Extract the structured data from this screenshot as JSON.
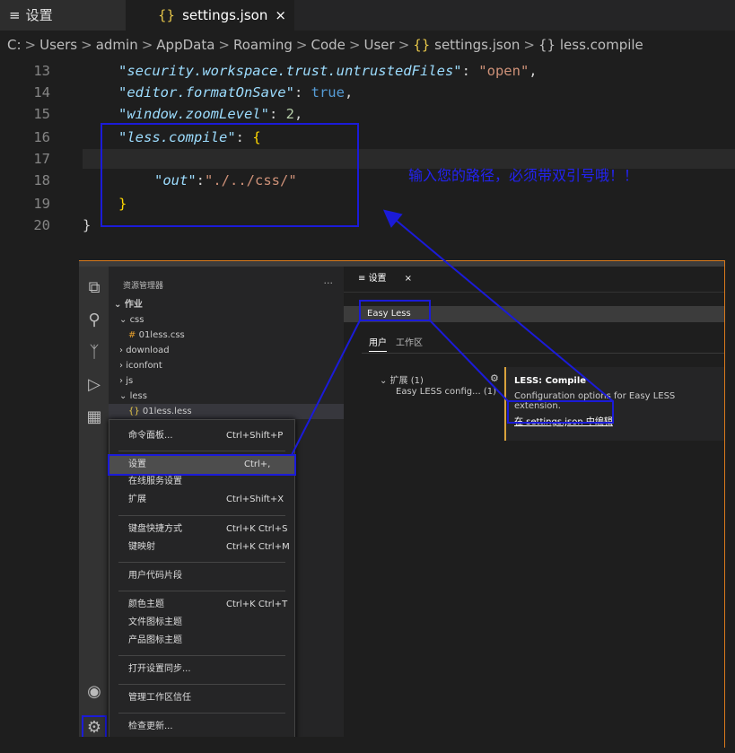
{
  "tabs": [
    {
      "label": "设置",
      "icon": "≡"
    },
    {
      "label": "settings.json",
      "icon": "{}",
      "close": "×"
    }
  ],
  "breadcrumb": [
    "C:",
    "Users",
    "admin",
    "AppData",
    "Roaming",
    "Code",
    "User",
    "settings.json",
    "less.compile"
  ],
  "code": {
    "lines": [
      {
        "n": "13"
      },
      {
        "n": "14"
      },
      {
        "n": "15"
      },
      {
        "n": "16"
      },
      {
        "n": "17"
      },
      {
        "n": "18"
      },
      {
        "n": "19"
      },
      {
        "n": "20"
      }
    ],
    "l13": {
      "key": "\"security.workspace.trust.untrustedFiles\"",
      "val": "\"open\""
    },
    "l14": {
      "key": "\"editor.formatOnSave\"",
      "val": "true"
    },
    "l15": {
      "key": "\"window.zoomLevel\"",
      "val": "2"
    },
    "l16": {
      "key": "\"less.compile\"",
      "val": "{"
    },
    "l18": {
      "key": "\"out\"",
      "val": "\"./../css/\""
    },
    "l19": {
      "val": "}"
    },
    "l20": {
      "val": "}"
    }
  },
  "annotation": "输入您的路径，必须带双引号哦！！",
  "colors": {
    "annotation": "#2323f0",
    "highlight_box": "#1b1bd8",
    "accent": "#d97a1c"
  },
  "explorer": {
    "title": "资源管理器",
    "more": "···",
    "items": [
      "作业",
      "css",
      "01less.css",
      "download",
      "iconfont",
      "js",
      "less",
      "01less.less"
    ]
  },
  "menu": {
    "items": [
      {
        "label": "命令面板...",
        "shortcut": "Ctrl+Shift+P"
      },
      {
        "label": "设置",
        "shortcut": "Ctrl+,"
      },
      {
        "label": "在线服务设置",
        "shortcut": ""
      },
      {
        "label": "扩展",
        "shortcut": "Ctrl+Shift+X"
      },
      {
        "label": "键盘快捷方式",
        "shortcut": "Ctrl+K Ctrl+S"
      },
      {
        "label": "键映射",
        "shortcut": "Ctrl+K Ctrl+M"
      },
      {
        "label": "用户代码片段",
        "shortcut": ""
      },
      {
        "label": "颜色主题",
        "shortcut": "Ctrl+K Ctrl+T"
      },
      {
        "label": "文件图标主题",
        "shortcut": ""
      },
      {
        "label": "产品图标主题",
        "shortcut": ""
      },
      {
        "label": "打开设置同步...",
        "shortcut": ""
      },
      {
        "label": "管理工作区信任",
        "shortcut": ""
      },
      {
        "label": "检查更新...",
        "shortcut": ""
      }
    ]
  },
  "settings": {
    "tab_label": "设置",
    "tab_close": "×",
    "search_value": "Easy Less",
    "scope_user": "用户",
    "scope_workspace": "工作区",
    "toc_ext": "扩展 (1)",
    "toc_item": "Easy LESS config... (1)",
    "detail_title": "LESS: Compile",
    "detail_desc": "Configuration options for Easy LESS extension.",
    "detail_link": "在 settings.json 中编辑"
  }
}
